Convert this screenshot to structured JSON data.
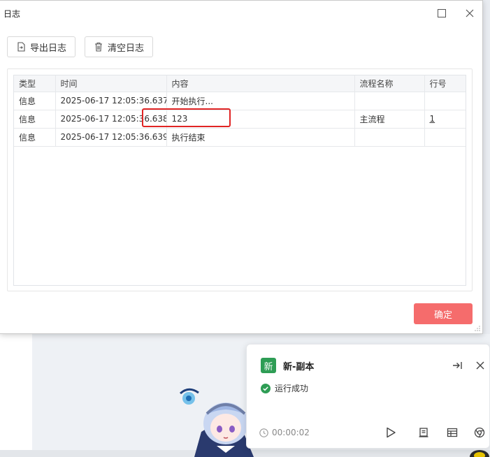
{
  "dialog": {
    "title": "日志",
    "toolbar": {
      "export_label": "导出日志",
      "clear_label": "清空日志"
    },
    "table": {
      "columns": [
        "类型",
        "时间",
        "内容",
        "流程名称",
        "行号"
      ],
      "rows": [
        {
          "type": "信息",
          "time": "2025-06-17 12:05:36.637",
          "content": "开始执行...",
          "flow": "",
          "line": ""
        },
        {
          "type": "信息",
          "time": "2025-06-17 12:05:36.638",
          "content": "123",
          "flow": "主流程",
          "line": "1"
        },
        {
          "type": "信息",
          "time": "2025-06-17 12:05:36.639",
          "content": "执行结束",
          "flow": "",
          "line": ""
        }
      ]
    },
    "ok_label": "确定"
  },
  "notification": {
    "badge": "新",
    "title": "新-副本",
    "status": "运行成功",
    "elapsed": "00:00:02"
  },
  "colors": {
    "ok_button": "#f56c6c",
    "badge": "#2e9d55",
    "success": "#2e9d55",
    "highlight": "#e02424"
  }
}
